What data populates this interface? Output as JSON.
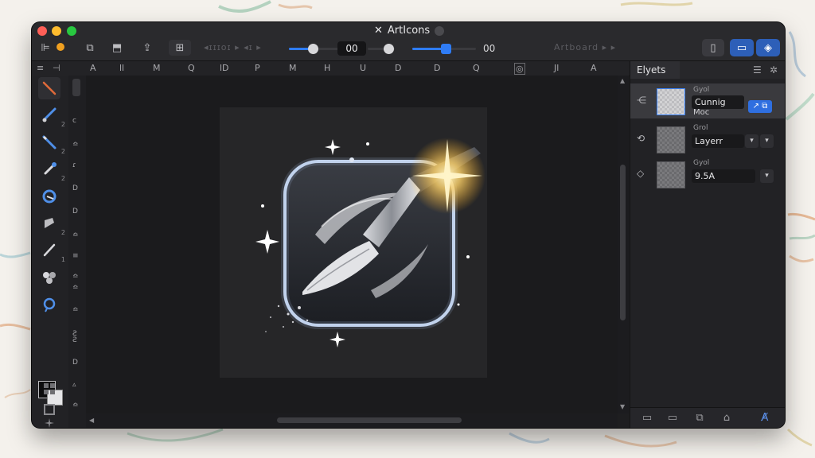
{
  "window": {
    "title": "ArtIcons",
    "title_icon": "artboard-icon"
  },
  "toolbar": {
    "dim_left": "◂ɪɪɪoɪ ▸ ◂ɪ ▸",
    "slider1_value": "00",
    "slider1_fill": 0.45,
    "slider2_value": "00",
    "slider2_fill": 0.5,
    "dim_right": "Artboard ▸ ▸"
  },
  "ruler": {
    "labels": [
      "A",
      "ll",
      "M",
      "Q",
      "lD",
      "P",
      "M",
      "H",
      "U",
      "D",
      "D",
      "Q",
      "A",
      "Jl",
      "A"
    ]
  },
  "vertical_strip": {
    "labels": [
      "c",
      "≏",
      "ɾ",
      "D",
      "D",
      "≏",
      "≡",
      "≏",
      "≏",
      "≏",
      "Ƨ",
      "Ƨ",
      "D",
      "▵",
      "≏"
    ]
  },
  "tools": {
    "items": [
      {
        "name": "pen-tool-icon",
        "n": ""
      },
      {
        "name": "brush-tool-icon",
        "n": "2"
      },
      {
        "name": "pencil-tool-icon",
        "n": "2"
      },
      {
        "name": "dropper-tool-icon",
        "n": "2"
      },
      {
        "name": "smudge-tool-icon",
        "n": ""
      },
      {
        "name": "blend-tool-icon",
        "n": "2"
      },
      {
        "name": "knife-tool-icon",
        "n": "1"
      },
      {
        "name": "shapes-tool-icon",
        "n": ""
      },
      {
        "name": "lasso-tool-icon",
        "n": ""
      },
      {
        "name": "grid-tool-icon",
        "n": ""
      },
      {
        "name": "crop-tool-icon",
        "n": ""
      },
      {
        "name": "sparkle-tool-icon",
        "n": ""
      }
    ]
  },
  "panel": {
    "tab": "Elyets",
    "layers": [
      {
        "vis": "⋲",
        "name_a": "Gyol",
        "field": "Cunnig",
        "sub": "Moc",
        "button": "↗ ⧉"
      },
      {
        "vis": "⟲",
        "name_a": "Grol",
        "field": "Layerr",
        "dropdown": "▾"
      },
      {
        "vis": "◇",
        "name_a": "Gyol",
        "field": "9.5A",
        "dropdown": "▾"
      }
    ],
    "footer_right": "A̸"
  },
  "colors": {
    "accent": "#2f7cf6",
    "window_bg": "#1e1e20",
    "artboard": "#262628"
  }
}
